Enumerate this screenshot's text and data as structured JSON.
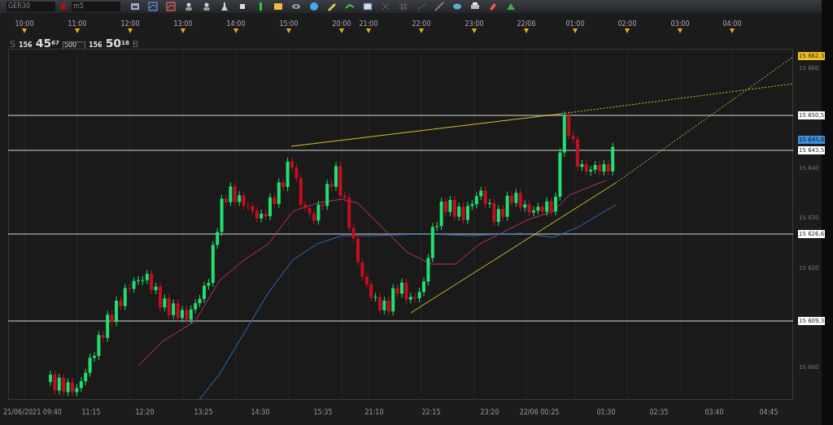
{
  "toolbar": {
    "symbol": "GER30",
    "timeframe": "m5"
  },
  "top_time_axis": [
    "10:00",
    "11:00",
    "12:00",
    "13:00",
    "14:00",
    "15:00",
    "20:00",
    "21:00",
    "22:00",
    "23:00",
    "22/06",
    "01:00",
    "02:00",
    "03:00",
    "04:00"
  ],
  "quote": {
    "sell_label": "S",
    "sell_big": "156",
    "sell_price": "45$^{67}$",
    "volume": "500",
    "buy_big": "156",
    "buy_price": "50$^{18}$",
    "buy_label": "B"
  },
  "price_axis": [
    {
      "kind": "trend",
      "text": "15 662,3"
    },
    {
      "kind": "tick",
      "text": "15 660"
    },
    {
      "kind": "line",
      "text": "15 650,5"
    },
    {
      "kind": "current",
      "text": "15 645,6"
    },
    {
      "kind": "line",
      "text": "15 643,5"
    },
    {
      "kind": "tick",
      "text": "15 640"
    },
    {
      "kind": "tick",
      "text": "15 630"
    },
    {
      "kind": "line",
      "text": "15 626,6"
    },
    {
      "kind": "tick",
      "text": "15 620"
    },
    {
      "kind": "line",
      "text": "15 609,3"
    },
    {
      "kind": "tick",
      "text": "15 600"
    }
  ],
  "bottom_time_axis": [
    "21/06/2021 09:40",
    "11:15",
    "12:20",
    "13:25",
    "14:30",
    "15:35",
    "21:10",
    "22:15",
    "23:20",
    "22/06 00:25",
    "01:30",
    "02:35",
    "03:40",
    "04:45"
  ]
}
